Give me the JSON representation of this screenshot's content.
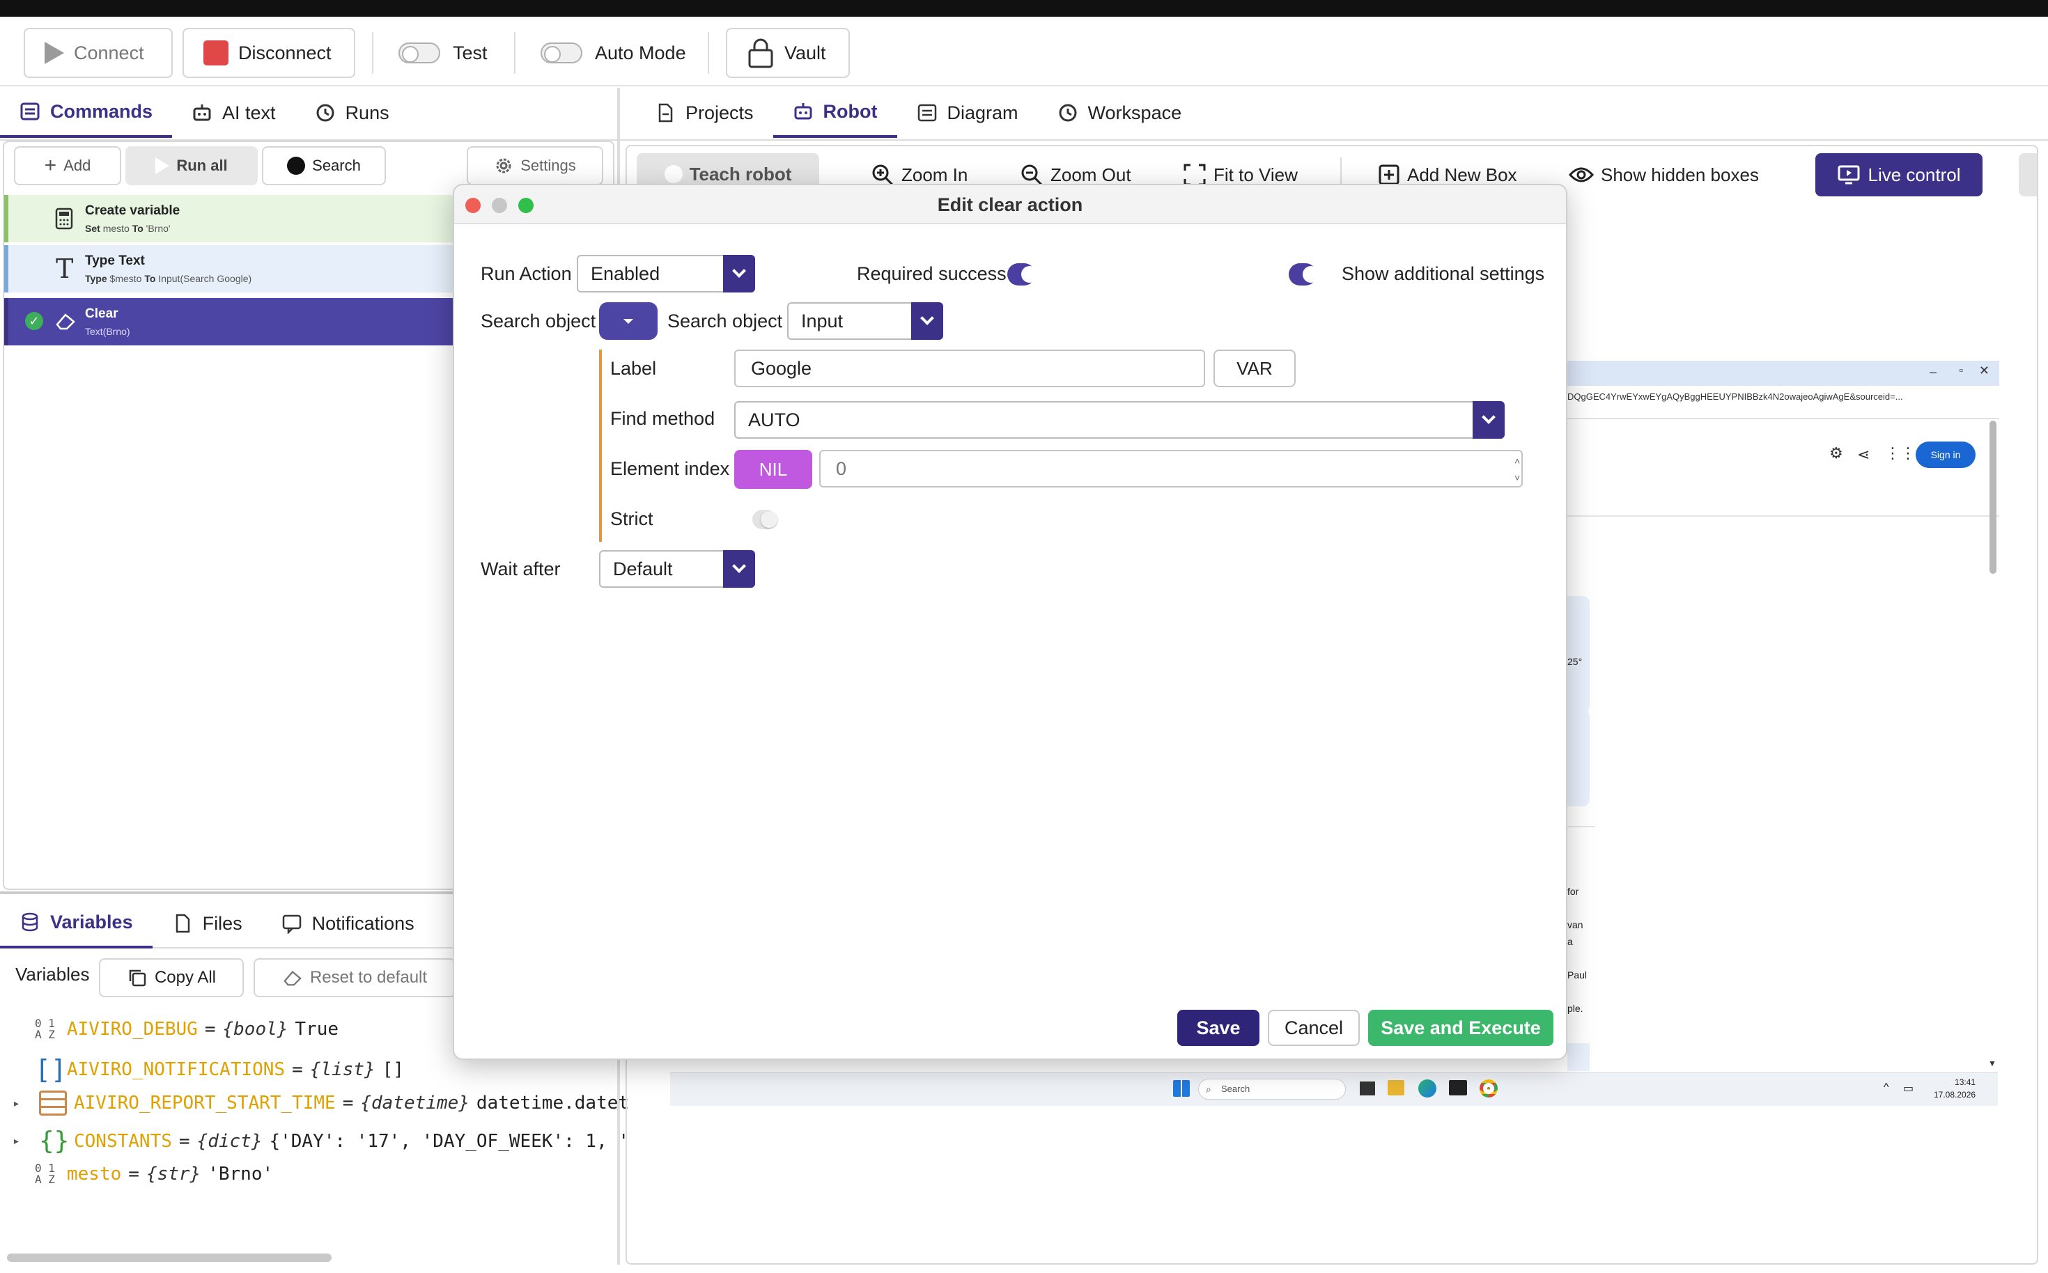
{
  "toolbar": {
    "connect": "Connect",
    "disconnect": "Disconnect",
    "test": "Test",
    "auto_mode": "Auto Mode",
    "vault": "Vault"
  },
  "left_tabs": [
    "Commands",
    "AI text",
    "Runs"
  ],
  "commands_bar": {
    "add": "Add",
    "run_all": "Run all",
    "search": "Search",
    "settings": "Settings"
  },
  "commands": [
    {
      "title": "Create variable",
      "sub_kw1": "Set",
      "sub_v1": "mesto",
      "sub_kw2": "To",
      "sub_v2": "'Brno'",
      "color": "#e7f5e1",
      "bar": "#8cc06a"
    },
    {
      "title": "Type Text",
      "sub_kw1": "Type",
      "sub_v1": "$mesto",
      "sub_kw2": "To",
      "sub_v2": "Input(Search Google)",
      "color": "#e7f0fa",
      "bar": "#7aa8dc"
    },
    {
      "title": "Clear",
      "sub": "Text(Brno)",
      "color": "#4d45a3",
      "bar": "#3b3189"
    }
  ],
  "bottom_tabs": [
    "Variables",
    "Files",
    "Notifications"
  ],
  "variables_bar": {
    "label": "Variables",
    "copy_all": "Copy All",
    "reset": "Reset to default"
  },
  "variables": [
    {
      "icon": "01AZ",
      "name": "AIVIRO_DEBUG",
      "type": "{bool}",
      "value": "True"
    },
    {
      "icon": "[]",
      "name": "AIVIRO_NOTIFICATIONS",
      "type": "{list}",
      "value": "[]"
    },
    {
      "icon": "dt",
      "name": "AIVIRO_REPORT_START_TIME",
      "type": "{datetime}",
      "value": "datetime.datet"
    },
    {
      "icon": "{}",
      "name": "CONSTANTS",
      "type": "{dict}",
      "value": "{'DAY': '17', 'DAY_OF_WEEK': 1, '"
    },
    {
      "icon": "01AZ",
      "name": "mesto",
      "type": "{str}",
      "value": "'Brno'"
    }
  ],
  "right_tabs": [
    "Projects",
    "Robot",
    "Diagram",
    "Workspace"
  ],
  "robot_toolbar": {
    "teach": "Teach robot",
    "zoom_in": "Zoom In",
    "zoom_out": "Zoom Out",
    "fit": "Fit to View",
    "add_box": "Add New Box",
    "show_hidden": "Show hidden boxes",
    "live": "Live control"
  },
  "preview": {
    "url_snippet": "DQgGEC4YrwEYxwEYgAQyBggHEEUYPNIBBzk4N2owajeoAgiwAgE&sourceid=...",
    "sign_in": "Sign in",
    "search": "Search",
    "time": "13:41",
    "date": "17.08.2026",
    "temp": "25°",
    "frag1": "for",
    "frag2": "van",
    "frag3": "a",
    "frag4": "Paul",
    "frag5": "ple."
  },
  "dialog": {
    "title": "Edit clear action",
    "run_action_label": "Run Action",
    "run_action_value": "Enabled",
    "required_success": "Required success",
    "show_additional": "Show additional settings",
    "search_object_label": "Search object",
    "search_object_label2": "Search object",
    "search_object_value": "Input",
    "label_label": "Label",
    "label_value": "Google",
    "var_button": "VAR",
    "find_method_label": "Find method",
    "find_method_value": "AUTO",
    "element_index_label": "Element index",
    "nil_button": "NIL",
    "element_index_value": "0",
    "strict_label": "Strict",
    "wait_after_label": "Wait after",
    "wait_after_value": "Default",
    "save": "Save",
    "cancel": "Cancel",
    "save_execute": "Save and Execute"
  }
}
